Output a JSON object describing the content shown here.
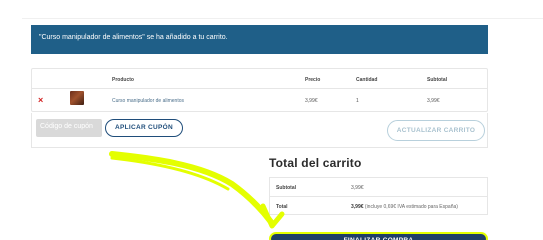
{
  "notice": {
    "message": "\"Curso manipulador de alimentos\" se ha añadido a tu carrito."
  },
  "cart": {
    "headers": {
      "product": "Producto",
      "price": "Precio",
      "quantity": "Cantidad",
      "subtotal": "Subtotal"
    },
    "items": [
      {
        "remove": "×",
        "product": "Curso manipulador de alimentos",
        "price": "3,99€",
        "quantity": "1",
        "subtotal": "3,99€"
      }
    ]
  },
  "actions": {
    "coupon_placeholder": "Código de cupón",
    "apply_coupon": "APLICAR CUPÓN",
    "update_cart": "ACTUALIZAR CARRITO"
  },
  "totals": {
    "title": "Total del carrito",
    "subtotal_label": "Subtotal",
    "subtotal_value": "3,99€",
    "total_label": "Total",
    "total_value": "3,99€",
    "total_note": "(incluye 0,69€ IVA estimado para España)"
  },
  "checkout": {
    "label": "FINALIZAR COMPRA"
  },
  "colors": {
    "notice_bg": "#1f5f88",
    "accent": "#1f4d7a",
    "remove": "#d21f1f",
    "highlight": "#e4ff00"
  }
}
